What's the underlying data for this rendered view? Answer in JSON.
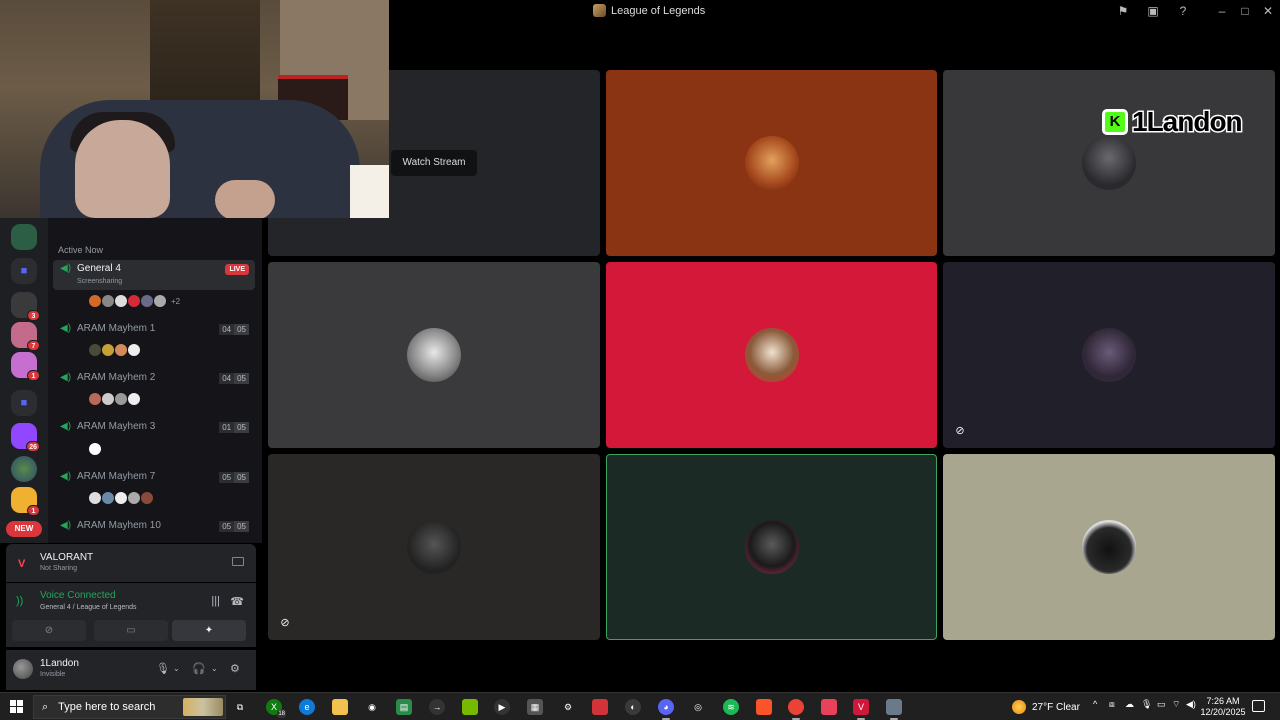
{
  "window": {
    "title": "League of Legends"
  },
  "tooltip": {
    "watch_stream": "Watch Stream"
  },
  "stream_overlay": {
    "kick_logo_letter": "K",
    "streamer_name": "1Landon"
  },
  "servers": {
    "badges": [
      "3",
      "7",
      "1",
      "26",
      "1"
    ],
    "new_label": "NEW"
  },
  "channels": {
    "section_title": "Active Now",
    "items": [
      {
        "name": "General 4",
        "subtitle": "Screensharing",
        "badge": "LIVE",
        "overflow": "+2"
      },
      {
        "name": "ARAM Mayhem 1",
        "current": "04",
        "limit": "05"
      },
      {
        "name": "ARAM Mayhem 2",
        "current": "04",
        "limit": "05"
      },
      {
        "name": "ARAM Mayhem 3",
        "current": "01",
        "limit": "05"
      },
      {
        "name": "ARAM Mayhem 7",
        "current": "05",
        "limit": "05"
      },
      {
        "name": "ARAM Mayhem 10",
        "current": "05",
        "limit": "05"
      }
    ]
  },
  "activity": {
    "game": "VALORANT",
    "status": "Not Sharing"
  },
  "voice": {
    "status": "Voice Connected",
    "location": "General 4 / League of Legends"
  },
  "user": {
    "name": "1Landon",
    "status": "Invisible"
  },
  "taskbar": {
    "search_placeholder": "Type here to search",
    "xbox_badge": "18",
    "weather": "27°F  Clear",
    "time": "7:26 AM",
    "date": "12/20/2025"
  },
  "colors": {
    "discord_green": "#23a55a",
    "live_red": "#da373c",
    "kick_green": "#53fc18"
  }
}
